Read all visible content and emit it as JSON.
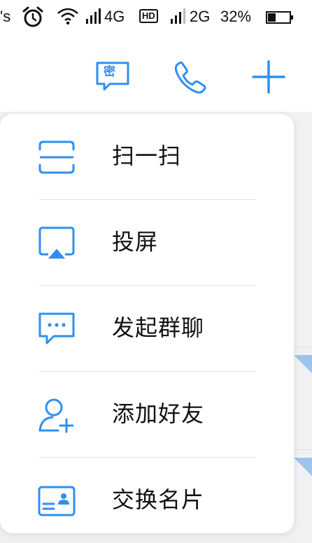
{
  "status_bar": {
    "left_text": "'s",
    "network_1": "4G",
    "hd_badge": "HD",
    "network_2": "2G",
    "battery": "32%"
  },
  "header": {
    "icons": [
      "secret-chat-icon",
      "phone-icon",
      "plus-icon"
    ],
    "secret_label": "密"
  },
  "menu": {
    "items": [
      {
        "label": "扫一扫",
        "icon": "scan-icon"
      },
      {
        "label": "投屏",
        "icon": "screen-cast-icon"
      },
      {
        "label": "发起群聊",
        "icon": "group-chat-icon"
      },
      {
        "label": "添加好友",
        "icon": "add-friend-icon"
      },
      {
        "label": "交换名片",
        "icon": "business-card-icon"
      }
    ]
  },
  "colors": {
    "accent": "#2e8ff0",
    "text": "#111111",
    "divider": "#e4e4e4",
    "background": "#f1f1f3"
  }
}
